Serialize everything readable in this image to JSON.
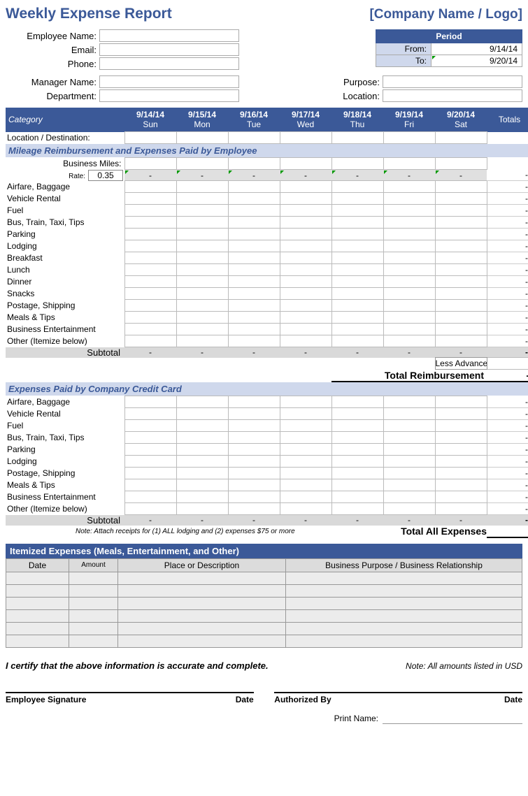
{
  "header": {
    "title": "Weekly Expense Report",
    "company": "[Company Name / Logo]"
  },
  "employee": {
    "name_label": "Employee Name:",
    "email_label": "Email:",
    "phone_label": "Phone:",
    "manager_label": "Manager Name:",
    "department_label": "Department:"
  },
  "period": {
    "header": "Period",
    "from_label": "From:",
    "to_label": "To:",
    "from_value": "9/14/14",
    "to_value": "9/20/14"
  },
  "purpose_label": "Purpose:",
  "location_label": "Location:",
  "columns": {
    "category": "Category",
    "totals": "Totals",
    "days": [
      {
        "date": "9/14/14",
        "name": "Sun"
      },
      {
        "date": "9/15/14",
        "name": "Mon"
      },
      {
        "date": "9/16/14",
        "name": "Tue"
      },
      {
        "date": "9/17/14",
        "name": "Wed"
      },
      {
        "date": "9/18/14",
        "name": "Thu"
      },
      {
        "date": "9/19/14",
        "name": "Fri"
      },
      {
        "date": "9/20/14",
        "name": "Sat"
      }
    ]
  },
  "location_dest_label": "Location / Destination:",
  "section1": {
    "title": "Mileage Reimbursement and Expenses Paid by Employee",
    "business_miles": "Business Miles:",
    "rate_label": "Rate:",
    "rate_value": "0.35",
    "rows": [
      "Airfare, Baggage",
      "Vehicle Rental",
      "Fuel",
      "Bus, Train, Taxi, Tips",
      "Parking",
      "Lodging",
      "Breakfast",
      "Lunch",
      "Dinner",
      "Snacks",
      "Postage, Shipping",
      "Meals & Tips",
      "Business Entertainment",
      "Other (Itemize below)"
    ],
    "subtotal": "Subtotal",
    "less_advances": "Less Advances",
    "total_reimbursement": "Total Reimbursement"
  },
  "section2": {
    "title": "Expenses Paid by Company Credit Card",
    "rows": [
      "Airfare, Baggage",
      "Vehicle Rental",
      "Fuel",
      "Bus, Train, Taxi, Tips",
      "Parking",
      "Lodging",
      "Postage, Shipping",
      "Meals & Tips",
      "Business Entertainment",
      "Other (Itemize below)"
    ],
    "subtotal": "Subtotal",
    "note": "Note:  Attach receipts for (1) ALL lodging and (2) expenses $75 or more",
    "total_all": "Total All Expenses"
  },
  "itemized": {
    "title": "Itemized Expenses (Meals, Entertainment, and Other)",
    "cols": {
      "date": "Date",
      "amount": "Amount",
      "place": "Place or Description",
      "purpose": "Business Purpose / Business Relationship"
    }
  },
  "certify": "I certify that the above information is accurate and complete.",
  "note_usd": "Note: All amounts listed in USD",
  "sig": {
    "employee": "Employee Signature",
    "date": "Date",
    "authorized": "Authorized By",
    "print_name": "Print Name:"
  },
  "dash": "-"
}
